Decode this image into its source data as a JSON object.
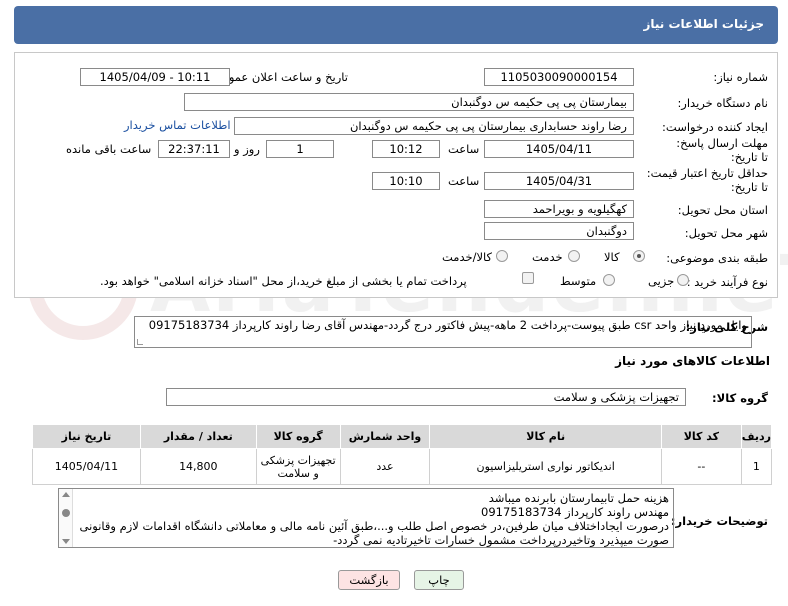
{
  "header": {
    "title": "جزئیات اطلاعات نیاز"
  },
  "form": {
    "need_number_label": "شماره نیاز:",
    "need_number": "1105030090000154",
    "announce_label": "تاریخ و ساعت اعلان عمومی:",
    "announce_value": "1405/04/09 - 10:11",
    "buyer_org_label": "نام دستگاه خریدار:",
    "buyer_org": "بیمارستان پی پی حکیمه س  دوگنبدان",
    "requester_label": "ایجاد کننده درخواست:",
    "requester": "رضا راوند حسابداری بیمارستان پی پی حکیمه س  دوگنبدان",
    "contact_link": "اطلاعات تماس خریدار",
    "deadline_label": "مهلت ارسال پاسخ: تا تاریخ:",
    "deadline_date": "1405/04/11",
    "time_label": "ساعت",
    "deadline_time": "10:12",
    "days_count": "1",
    "days_label": "روز و",
    "remaining_time": "22:37:11",
    "remaining_label": "ساعت باقی مانده",
    "validity_label": "حداقل تاریخ اعتبار قیمت: تا تاریخ:",
    "validity_date": "1405/04/31",
    "validity_time": "10:10",
    "province_label": "استان محل تحویل:",
    "province": "کهگیلویه و بویراحمد",
    "city_label": "شهر محل تحویل:",
    "city": "دوگنبدان",
    "category_label": "طبقه بندی موضوعی:",
    "category_options": [
      "کالا",
      "خدمت",
      "کالا/خدمت"
    ],
    "category_selected": "کالا",
    "process_label": "نوع فرآیند خرید :",
    "process_options": [
      "جزیی",
      "متوسط"
    ],
    "payment_note": "پرداخت تمام یا بخشی از مبلغ خرید،از محل \"اسناد خزانه اسلامی\" خواهد بود."
  },
  "description": {
    "label": "شرح کلی نیاز:",
    "text": "وایل مورد نیاز واحد csr طبق پیوست-پرداخت 2 ماهه-پیش فاکتور درج گردد-مهندس آقای رضا راوند کارپرداز 09175183734"
  },
  "goods": {
    "section_title": "اطلاعات کالاهای مورد نیاز",
    "group_label": "گروه کالا:",
    "group_value": "تجهیزات پزشکی و سلامت",
    "columns": [
      "ردیف",
      "کد کالا",
      "نام کالا",
      "واحد شمارش",
      "گروه کالا",
      "تعداد / مقدار",
      "تاریخ نیاز"
    ],
    "rows": [
      [
        "1",
        "--",
        "اندیکاتور نواری استریلیزاسیون",
        "عدد",
        "تجهیزات پزشکی و سلامت",
        "14,800",
        "1405/04/11"
      ]
    ]
  },
  "buyer_notes": {
    "label": "توضیحات خریدار:",
    "lines": [
      "هزینه حمل تابیمارستان بابرنده میباشد",
      "مهندس  راوند کارپرداز 09175183734",
      "درصورت ایجاداختلاف میان طرفین،در خصوص اصل طلب و...،طبق آئین نامه مالی و معاملاتی دانشگاه اقدامات لازم وقانونی",
      "صورت میپذیرد وتاخیردرپرداخت مشمول خسارات تاخیرتادیه نمی گردد-"
    ]
  },
  "buttons": {
    "print": "چاپ",
    "back": "بازگشت"
  },
  "colors": {
    "header_bg": "#4a6fa5",
    "link": "#1a4fa0",
    "back_bg": "#fde3e3",
    "print_bg": "#e6f4e6"
  }
}
